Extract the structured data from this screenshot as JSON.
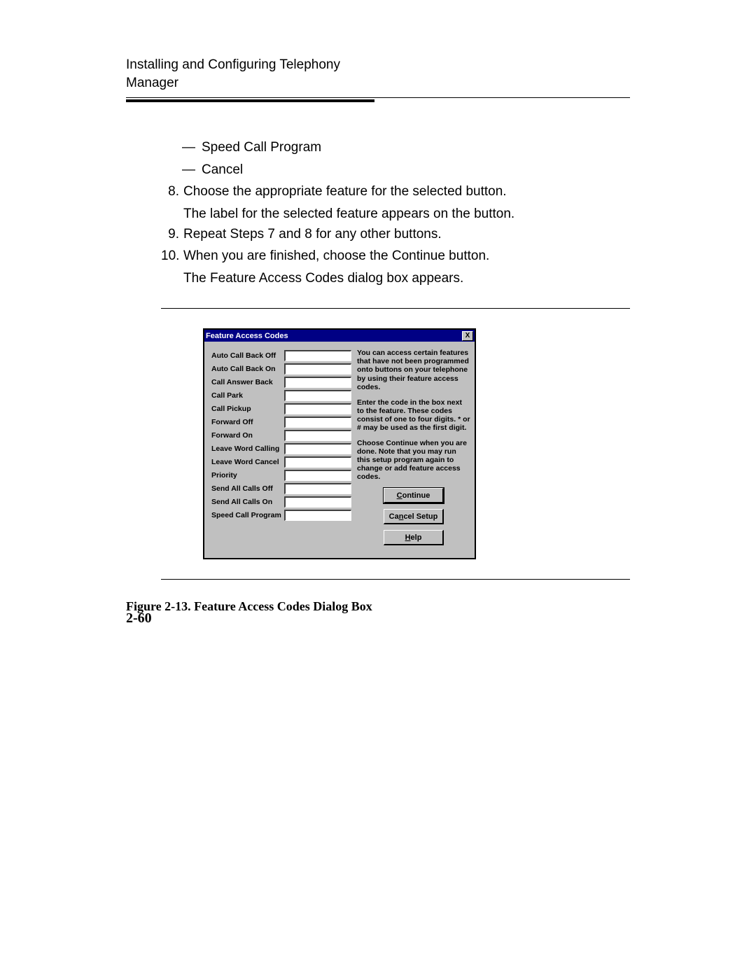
{
  "header_line1": "Installing and Configuring Telephony",
  "header_line2": "Manager",
  "bullets": {
    "b1": "Speed Call Program",
    "b2": "Cancel"
  },
  "steps": {
    "n8": "8.",
    "t8a": "Choose the appropriate feature for the selected button.",
    "t8b": "The label for the selected feature appears on the button.",
    "n9": "9.",
    "t9": "Repeat Steps 7 and 8 for any other buttons.",
    "n10": "10.",
    "t10a": "When you are finished, choose the Continue button.",
    "t10b": "The Feature Access Codes dialog box appears."
  },
  "dialog": {
    "title": "Feature Access Codes",
    "close": "X",
    "features": [
      "Auto Call Back Off",
      "Auto Call Back On",
      "Call Answer Back",
      "Call Park",
      "Call Pickup",
      "Forward Off",
      "Forward On",
      "Leave Word Calling",
      "Leave Word Cancel",
      "Priority",
      "Send All Calls Off",
      "Send All Calls On",
      "Speed Call Program"
    ],
    "p1": "You can access certain features that have not been programmed onto buttons on your telephone by using their feature access codes.",
    "p2": "Enter the code in the box next to the feature.  These codes consist of one to four digits. * or # may be used as the first digit.",
    "p3": "Choose Continue when you are done. Note that you may run this setup program again to change or add feature access codes.",
    "btn_continue_u": "C",
    "btn_continue_rest": "ontinue",
    "btn_cancel_pre": "Ca",
    "btn_cancel_u": "n",
    "btn_cancel_post": "cel Setup",
    "btn_help_u": "H",
    "btn_help_rest": "elp"
  },
  "caption": "Figure 2-13.  Feature Access Codes Dialog Box",
  "page_num": "2-60"
}
